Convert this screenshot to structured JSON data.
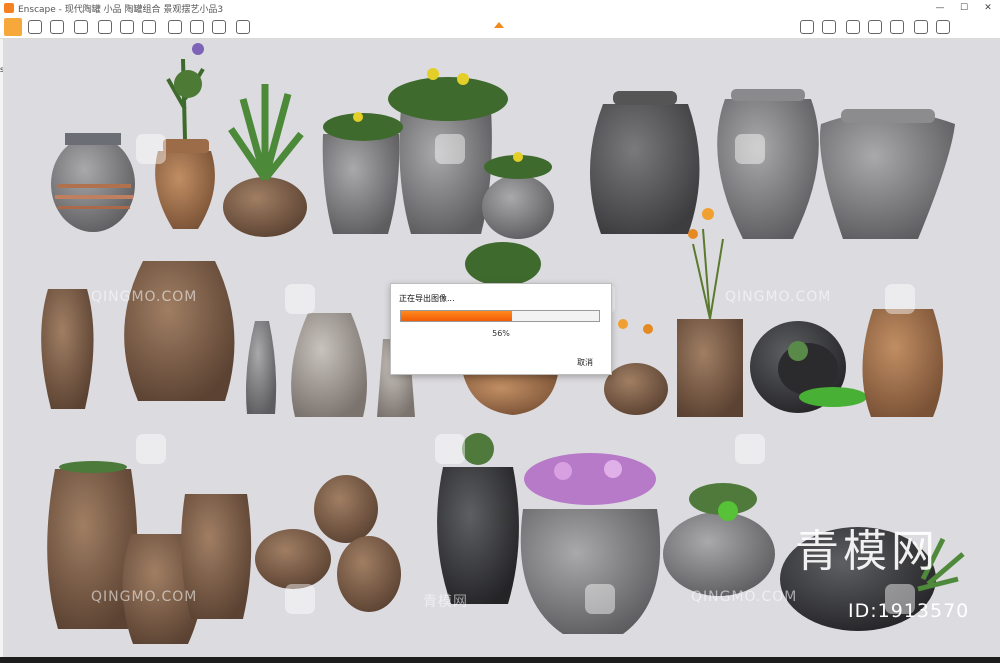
{
  "window": {
    "title": "Enscape - 现代陶罐 小品 陶罐组合 景观摆艺小品3",
    "min_label": "—",
    "max_label": "☐",
    "close_label": "✕",
    "accent_color": "#f58220"
  },
  "toolbar": {
    "icons": [
      "pointer-icon",
      "brush-icon",
      "eye-icon",
      "headset-icon",
      "cube-icon",
      "lightbulb-icon",
      "grid-icon",
      "image-icon",
      "crop-icon",
      "folder-icon",
      "camera-icon",
      "video-icon",
      "panorama-icon",
      "upload-icon",
      "settings-icon",
      "info-icon",
      "help-icon",
      "expand-icon"
    ]
  },
  "side_mark": "s",
  "export_dialog": {
    "title": "正在导出图像...",
    "progress_percent": 56,
    "progress_text": "56%",
    "cancel_label": "取消",
    "fill_color": "#f5730c"
  },
  "watermarks": {
    "site_text": "QINGMO.COM",
    "site_text_cn": "青模网",
    "logo_text": "青模网",
    "id_text": "ID:1913570"
  }
}
